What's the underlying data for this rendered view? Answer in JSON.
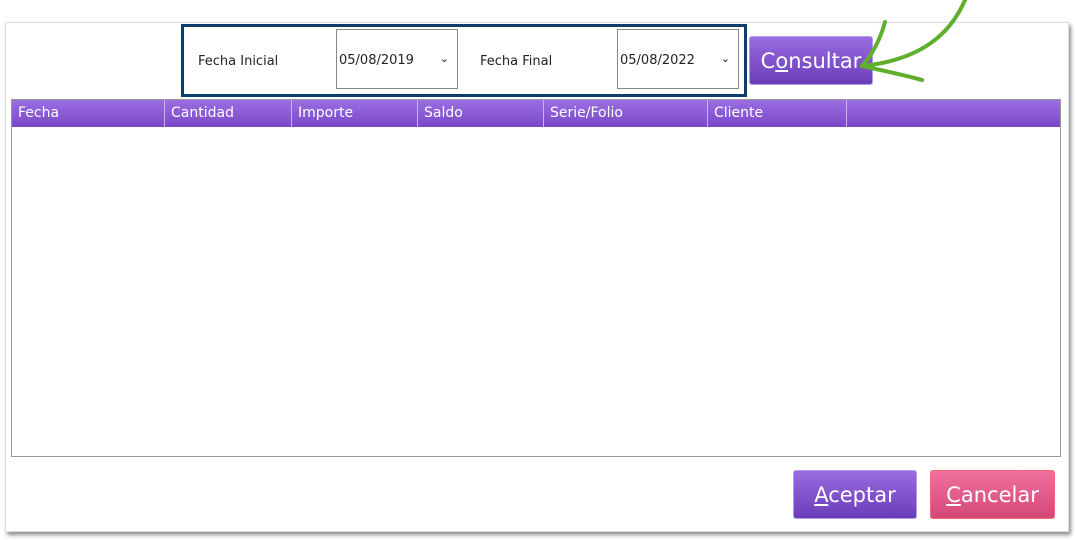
{
  "filters": {
    "fecha_inicial_label": "Fecha Inicial",
    "fecha_inicial_value": "05/08/2019",
    "fecha_final_label": "Fecha Final",
    "fecha_final_value": "05/08/2022"
  },
  "buttons": {
    "consultar_first": "C",
    "consultar_underlined": "o",
    "consultar_rest": "nsultar",
    "aceptar_underlined": "A",
    "aceptar_rest": "ceptar",
    "cancelar_underlined": "C",
    "cancelar_rest": "ancelar"
  },
  "grid": {
    "columns": [
      "Fecha",
      "Cantidad",
      "Importe",
      "Saldo",
      "Serie/Folio",
      "Cliente",
      ""
    ]
  },
  "icons": {
    "dropdown": "chevron-down-icon",
    "annotation": "green-arrow-icon"
  }
}
